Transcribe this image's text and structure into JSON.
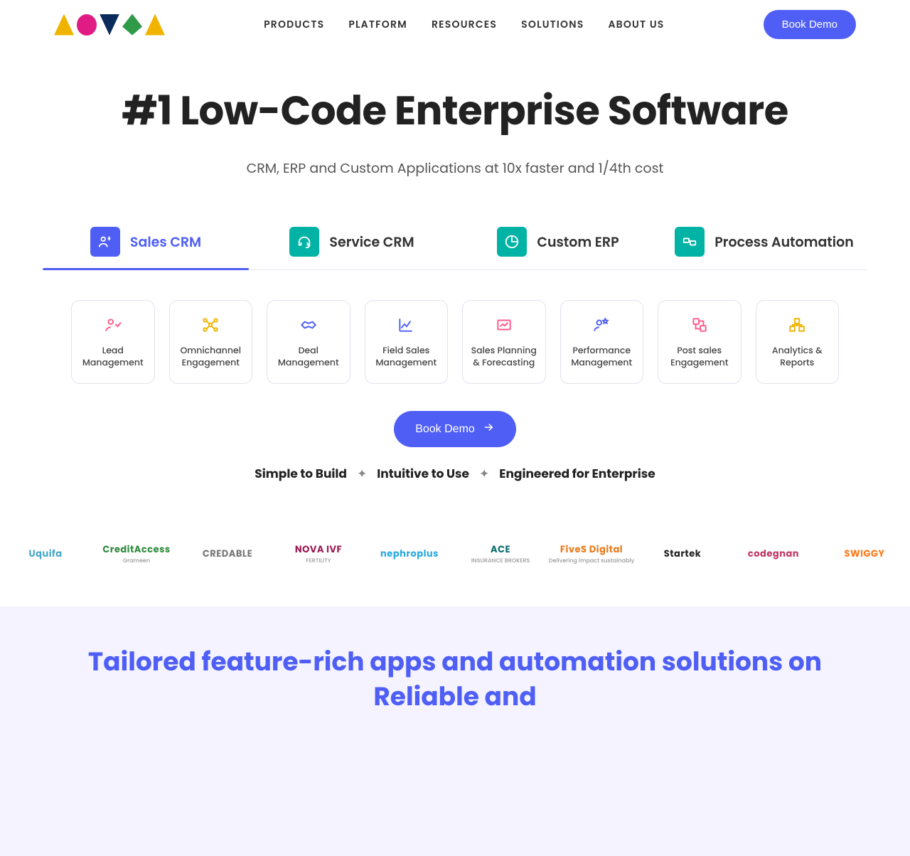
{
  "nav": {
    "items": [
      "PRODUCTS",
      "PLATFORM",
      "RESOURCES",
      "SOLUTIONS",
      "ABOUT US"
    ],
    "demo_label": "Book Demo"
  },
  "hero": {
    "title": "#1 Low-Code Enterprise Software",
    "subtitle": "CRM, ERP and Custom Applications at 10x faster and 1/4th cost"
  },
  "tabs": [
    {
      "label": "Sales CRM",
      "active": true
    },
    {
      "label": "Service CRM",
      "active": false
    },
    {
      "label": "Custom ERP",
      "active": false
    },
    {
      "label": "Process Automation",
      "active": false
    }
  ],
  "features": [
    {
      "label": "Lead Management",
      "icon": "lead",
      "color": "#ff5a8a"
    },
    {
      "label": "Omnichannel Engagement",
      "icon": "omni",
      "color": "#f0b400"
    },
    {
      "label": "Deal Management",
      "icon": "deal",
      "color": "#4f5ff5"
    },
    {
      "label": "Field Sales Management",
      "icon": "field",
      "color": "#4f5ff5"
    },
    {
      "label": "Sales Planning & Forecasting",
      "icon": "plan",
      "color": "#ff5a8a"
    },
    {
      "label": "Performance Management",
      "icon": "perf",
      "color": "#4f5ff5"
    },
    {
      "label": "Post sales Engagement",
      "icon": "post",
      "color": "#ff5a8a"
    },
    {
      "label": "Analytics & Reports",
      "icon": "report",
      "color": "#f0b400"
    }
  ],
  "cta": {
    "label": "Book Demo"
  },
  "tagline": {
    "a": "Simple to Build",
    "b": "Intuitive to Use",
    "c": "Engineered for Enterprise"
  },
  "clients": [
    {
      "name": "Uquifa",
      "sub": "",
      "color": "#46a6c9"
    },
    {
      "name": "CreditAccess",
      "sub": "Grameen",
      "color": "#2f8a3c"
    },
    {
      "name": "CREDABLE",
      "sub": "",
      "color": "#777"
    },
    {
      "name": "NOVA IVF",
      "sub": "FERTILITY",
      "color": "#9a1a53"
    },
    {
      "name": "nephroplus",
      "sub": "",
      "color": "#2aa9e0"
    },
    {
      "name": "ACE",
      "sub": "INSURANCE BROKERS",
      "color": "#0a6b6b"
    },
    {
      "name": "FiveS Digital",
      "sub": "Delivering impact sustainably",
      "color": "#e97a1a"
    },
    {
      "name": "Startek",
      "sub": "",
      "color": "#222"
    },
    {
      "name": "codegnan",
      "sub": "",
      "color": "#c03565"
    },
    {
      "name": "SWIGGY",
      "sub": "",
      "color": "#ff7a1a"
    }
  ],
  "section2": {
    "heading": "Tailored feature-rich apps and automation solutions on Reliable and"
  },
  "logo_colors": [
    "#f0b400",
    "#e01b84",
    "#0a2b5c",
    "#2f9b49"
  ],
  "colors": {
    "blue": "#4f5ff5",
    "teal": "#00b3a4"
  }
}
